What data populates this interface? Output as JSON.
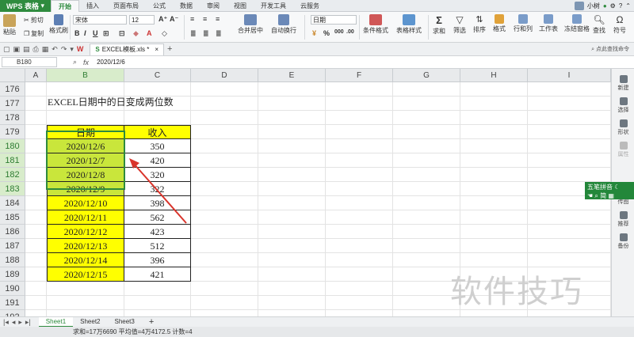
{
  "menubar": {
    "logo": "WPS 表格",
    "tabs": [
      "开始",
      "插入",
      "页面布局",
      "公式",
      "数据",
      "审阅",
      "视图",
      "开发工具",
      "云服务"
    ],
    "user": "小树"
  },
  "ribbon": {
    "paste": "粘贴",
    "cut": "剪切",
    "copy": "复制",
    "format_painter": "格式刷",
    "font_name": "宋体",
    "font_size": "12",
    "merge": "合并居中",
    "wrap": "自动换行",
    "number_format": "日期",
    "cond_format": "条件格式",
    "table_style": "表格样式",
    "sum": "求和",
    "filter": "筛选",
    "sort": "排序",
    "format": "格式",
    "rows_cols": "行和列",
    "worksheet": "工作表",
    "freeze": "冻结窗格",
    "find": "查找",
    "symbol": "符号"
  },
  "quickbar": {
    "doc_tab": "EXCEL模板.xls *",
    "search_cmd": "点此查找命令"
  },
  "formula": {
    "cell_ref": "B180",
    "fx": "fx",
    "value": "2020/12/6"
  },
  "columns": [
    "A",
    "B",
    "C",
    "D",
    "E",
    "F",
    "G",
    "H",
    "I"
  ],
  "rows": [
    "176",
    "177",
    "178",
    "179",
    "180",
    "181",
    "182",
    "183",
    "184",
    "185",
    "186",
    "187",
    "188",
    "189",
    "190",
    "191",
    "192",
    "193"
  ],
  "title_text": "EXCEL日期中的日变成两位数",
  "table": {
    "header_date": "日期",
    "header_income": "收入",
    "rows": [
      {
        "date": "2020/12/6",
        "income": "350"
      },
      {
        "date": "2020/12/7",
        "income": "420"
      },
      {
        "date": "2020/12/8",
        "income": "320"
      },
      {
        "date": "2020/12/9",
        "income": "322"
      },
      {
        "date": "2020/12/10",
        "income": "398"
      },
      {
        "date": "2020/12/11",
        "income": "562"
      },
      {
        "date": "2020/12/12",
        "income": "423"
      },
      {
        "date": "2020/12/13",
        "income": "512"
      },
      {
        "date": "2020/12/14",
        "income": "396"
      },
      {
        "date": "2020/12/15",
        "income": "421"
      }
    ]
  },
  "sidebar": {
    "items": [
      "新建",
      "选择",
      "形状",
      "属性",
      "传图",
      "推荐",
      "备份"
    ]
  },
  "ime": {
    "title": "五笔拼音",
    "label": "简"
  },
  "sheets": [
    "Sheet1",
    "Sheet2",
    "Sheet3"
  ],
  "add_sheet": "+",
  "status": "求和=17万6690  平均值=4万4172.5  计数=4",
  "watermark": "软件技巧",
  "colors": {
    "accent": "#2e8b3e",
    "yellow": "#ffff00",
    "selected_yellow": "#c9e63b",
    "arrow": "#d9342b"
  }
}
